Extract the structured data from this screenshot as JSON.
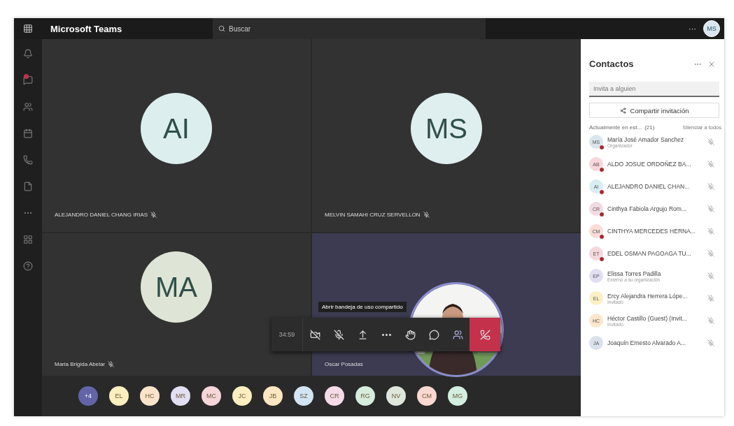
{
  "top_bar": {
    "app_title": "Microsoft Teams",
    "search": {
      "placeholder": "Buscar"
    },
    "more": "···",
    "avatar": "MS"
  },
  "rail": [
    {
      "kind": "activity",
      "badge": false
    },
    {
      "kind": "chat",
      "badge": true
    },
    {
      "kind": "teams",
      "badge": false
    },
    {
      "kind": "calendar",
      "badge": false
    },
    {
      "kind": "calls",
      "badge": false
    },
    {
      "kind": "files",
      "badge": false
    },
    {
      "kind": "more",
      "badge": false
    },
    {
      "kind": "apps",
      "badge": false
    },
    {
      "kind": "help",
      "badge": false
    }
  ],
  "tiles": [
    {
      "kind": "avatar",
      "initials": "AI",
      "name": "ALEJANDRO DANIEL CHANG IRIAS",
      "muted": true
    },
    {
      "kind": "avatar",
      "initials": "MS",
      "name": "MELVIN SAMAHI CRUZ SERVELLON",
      "muted": true
    },
    {
      "kind": "avatar",
      "initials": "MA",
      "name": "Maria Brigida Abelar",
      "muted": true
    },
    {
      "kind": "video",
      "name": "Oscar Posadas",
      "muted": false
    }
  ],
  "call_controls": {
    "timer": "34:59",
    "tooltip": "Abrir bandeja de uso compartido",
    "buttons": [
      {
        "kind": "camera-off"
      },
      {
        "kind": "mic-off"
      },
      {
        "kind": "share"
      },
      {
        "kind": "more"
      },
      {
        "kind": "hand"
      },
      {
        "kind": "chat"
      },
      {
        "kind": "people"
      },
      {
        "kind": "hangup"
      }
    ]
  },
  "roster": [
    {
      "initials": "+4",
      "color": "#6264a7"
    },
    {
      "initials": "EL",
      "color": "#fbefc0"
    },
    {
      "initials": "HC",
      "color": "#fde3c9"
    },
    {
      "initials": "MR",
      "color": "#e3dff2"
    },
    {
      "initials": "MC",
      "color": "#f7d6da"
    },
    {
      "initials": "JC",
      "color": "#fbefc0"
    },
    {
      "initials": "JB",
      "color": "#fde7c2"
    },
    {
      "initials": "SZ",
      "color": "#d3e4f5"
    },
    {
      "initials": "CR",
      "color": "#f5dbe8"
    },
    {
      "initials": "RG",
      "color": "#d6ecdc"
    },
    {
      "initials": "NV",
      "color": "#dfe6dc"
    },
    {
      "initials": "CM",
      "color": "#fbd9d0"
    },
    {
      "initials": "MG",
      "color": "#d3eee0"
    }
  ],
  "contacts": {
    "title": "Contactos",
    "invite": {
      "placeholder": "Invita a alguien"
    },
    "share_button": "Compartir invitación",
    "section": "Actualmente en est...",
    "count": "(21)",
    "mute_all": "Silenciar a todos",
    "people": [
      {
        "initials": "MS",
        "color": "#d9e6ef",
        "name": "María José Amador Sanchez",
        "role": "Organizador",
        "presence_dot": true
      },
      {
        "initials": "AB",
        "color": "#f7d6dc",
        "name": "ALDO JOSUE ORDOÑEZ BA...",
        "presence_dot": true
      },
      {
        "initials": "AI",
        "color": "#d8ecf3",
        "name": "ALEJANDRO DANIEL CHAN...",
        "presence_dot": true
      },
      {
        "initials": "CR",
        "color": "#f1dbe2",
        "name": "Cinthya Fabiola Argujo Rom...",
        "presence_dot": true
      },
      {
        "initials": "CM",
        "color": "#fbdcd6",
        "name": "CINTHYA MERCEDES HERNA...",
        "presence_dot": true
      },
      {
        "initials": "ET",
        "color": "#f5d8dc",
        "name": "EDEL OSMAN PAGOAGA TU...",
        "presence_dot": true
      },
      {
        "initials": "EP",
        "color": "#e1def3",
        "name": "Elissa Torres Padilla",
        "role": "Externo a su organización",
        "presence_dot": false
      },
      {
        "initials": "EL",
        "color": "#fbf0c4",
        "name": "Ercy Alejandra Herrera Lópe...",
        "role": "Invitado",
        "presence_dot": false
      },
      {
        "initials": "HC",
        "color": "#fde6cc",
        "name": "Héctor Castillo (Guest) (Invit...",
        "role": "Invitado",
        "presence_dot": false
      },
      {
        "initials": "JA",
        "color": "#d9e1ec",
        "name": "Joaquín Ernesto Alvarado A...",
        "presence_dot": false
      }
    ]
  }
}
